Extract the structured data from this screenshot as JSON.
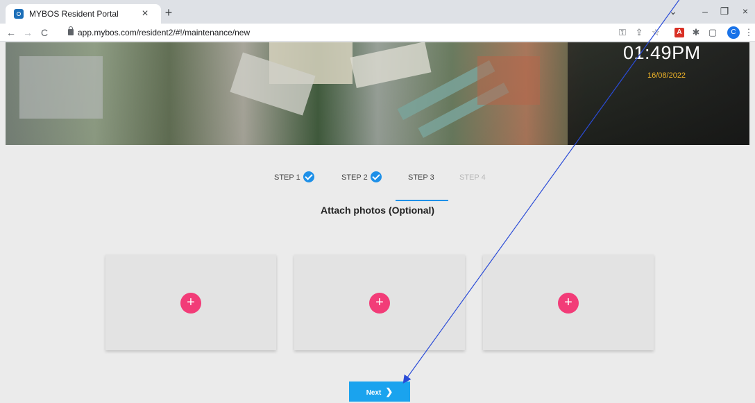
{
  "browser": {
    "tab_title": "MYBOS Resident Portal",
    "tab_close": "×",
    "new_tab": "+",
    "url": "app.mybos.com/resident2/#!/maintenance/new",
    "profile_initial": "C",
    "window_controls": {
      "chevron": "⌄",
      "minimize": "–",
      "restore": "❐",
      "close": "×"
    },
    "nav": {
      "back": "←",
      "forward": "→",
      "reload": "C"
    },
    "toolbar_icons": {
      "key": "⚿",
      "share": "⇪",
      "star": "☆",
      "pdf": "A",
      "extensions": "✱",
      "sidepanel": "▢",
      "menu": "⋮"
    }
  },
  "hero": {
    "time": "01:49PM",
    "date": "16/08/2022"
  },
  "stepper": {
    "steps": [
      {
        "label": "STEP 1",
        "state": "done"
      },
      {
        "label": "STEP 2",
        "state": "done"
      },
      {
        "label": "STEP 3",
        "state": "active"
      },
      {
        "label": "STEP 4",
        "state": "disabled"
      }
    ]
  },
  "content": {
    "title": "Attach photos (Optional)",
    "add_symbol": "+",
    "photo_slots": 3
  },
  "actions": {
    "next_label": "Next",
    "next_icon": "❯"
  },
  "colors": {
    "accent": "#1aa3ee",
    "add": "#f23c78",
    "date": "#f0b429",
    "check": "#1e90e8",
    "annotation_arrow": "#2a4bd7"
  }
}
